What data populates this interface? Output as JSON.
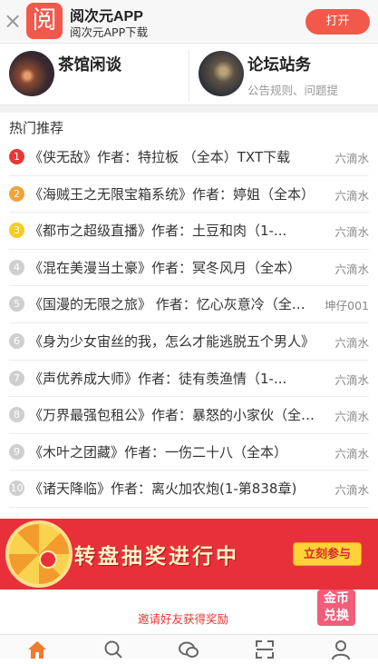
{
  "app_banner": {
    "logo_char": "阅",
    "app_name": "阅次元APP",
    "app_subtitle": "阅次元APP下载",
    "open_label": "打开",
    "close_symbol": "×",
    "accent_color": "#f2594b"
  },
  "forums": [
    {
      "title": "茶馆闲谈",
      "description": ""
    },
    {
      "title": "论坛站务",
      "description": "公告规则、问题提"
    }
  ],
  "hot_section": {
    "title": "热门推荐",
    "items": [
      {
        "rank": "1",
        "title": "《侠无敌》作者：特拉板 （全本）TXT下载",
        "author": "六滴水"
      },
      {
        "rank": "2",
        "title": "《海贼王之无限宝箱系统》作者：婷姐（全本）",
        "author": "六滴水"
      },
      {
        "rank": "3",
        "title": "《都市之超级直播》作者：土豆和肉（1-...",
        "author": "六滴水"
      },
      {
        "rank": "4",
        "title": "《混在美漫当土豪》作者：冥冬风月（全本）",
        "author": "六滴水"
      },
      {
        "rank": "5",
        "title": "《国漫的无限之旅》 作者：忆心灰意冷（全本）",
        "author": "坤仔001"
      },
      {
        "rank": "6",
        "title": "《身为少女宙丝的我，怎么才能逃脱五个男人》",
        "author": "六滴水"
      },
      {
        "rank": "7",
        "title": "《声优养成大师》作者：徒有羡渔情（1-...",
        "author": "六滴水"
      },
      {
        "rank": "8",
        "title": "《万界最强包租公》作者：暴怒的小家伙（全本）",
        "author": "六滴水"
      },
      {
        "rank": "9",
        "title": "《木叶之团藏》作者：一伤二十八（全本）",
        "author": "六滴水"
      },
      {
        "rank": "10",
        "title": "《诸天降临》作者：离火加农炮(1-第838章)",
        "author": "六滴水"
      }
    ]
  },
  "promo": {
    "headline": "转盘抽奖进行中",
    "join_label": "立刻参与",
    "invite_text": "邀请好友获得奖励",
    "coin_label_1": "金币",
    "coin_label_2": "兑换"
  },
  "bottom_nav": {
    "items": [
      "home-icon",
      "search-icon",
      "chat-icon",
      "scan-icon",
      "user-icon"
    ],
    "active_color": "#f07a2e"
  }
}
